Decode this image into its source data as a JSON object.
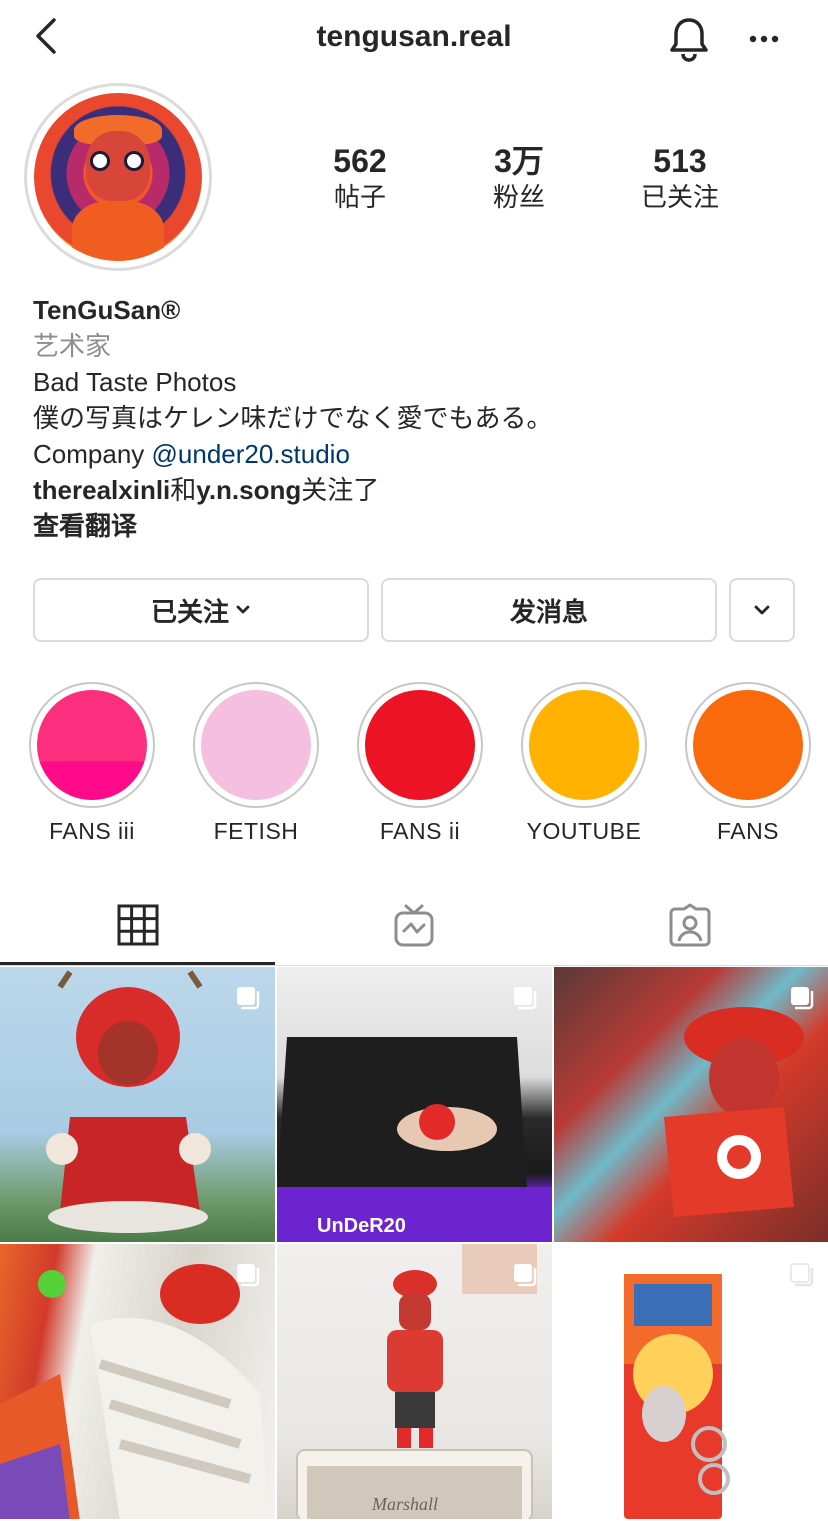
{
  "header": {
    "username": "tengusan.real"
  },
  "stats": [
    {
      "value": "562",
      "label": "帖子"
    },
    {
      "value": "3万",
      "label": "粉丝"
    },
    {
      "value": "513",
      "label": "已关注"
    }
  ],
  "bio": {
    "name": "TenGuSan®",
    "category": "艺术家",
    "line1": "Bad Taste Photos",
    "line2": "僕の写真はケレン味だけでなく愛でもある。",
    "company_prefix": "Company ",
    "company_link": "@under20.studio",
    "followed_by_user1": "therealxinli",
    "followed_by_and": "和",
    "followed_by_user2": "y.n.song",
    "followed_by_suffix": "关注了",
    "translate": "查看翻译"
  },
  "buttons": {
    "following": "已关注",
    "message": "发消息"
  },
  "highlights": [
    {
      "label": "FANS iii",
      "color_top": "#fb2f7e",
      "color_bottom": "#ff0a89"
    },
    {
      "label": "FETISH",
      "color_top": "#f5c0e0",
      "color_bottom": "#f5c0e0"
    },
    {
      "label": "FANS ii",
      "color_top": "#ec1325",
      "color_bottom": "#ec1325"
    },
    {
      "label": "YOUTUBE",
      "color_top": "#ffb200",
      "color_bottom": "#ffb200"
    },
    {
      "label": "FANS",
      "color_top": "#f86a0c",
      "color_bottom": "#f86a0c"
    }
  ],
  "grid_posts": [
    {
      "name": "post-santa-figure",
      "text": ""
    },
    {
      "name": "post-bag-keychain",
      "text": "UnDeR20"
    },
    {
      "name": "post-red-figure",
      "text": ""
    },
    {
      "name": "post-sneaker",
      "text": ""
    },
    {
      "name": "post-speaker-figure",
      "text": "Marshall"
    },
    {
      "name": "post-packaged-keychain",
      "text": ""
    }
  ]
}
